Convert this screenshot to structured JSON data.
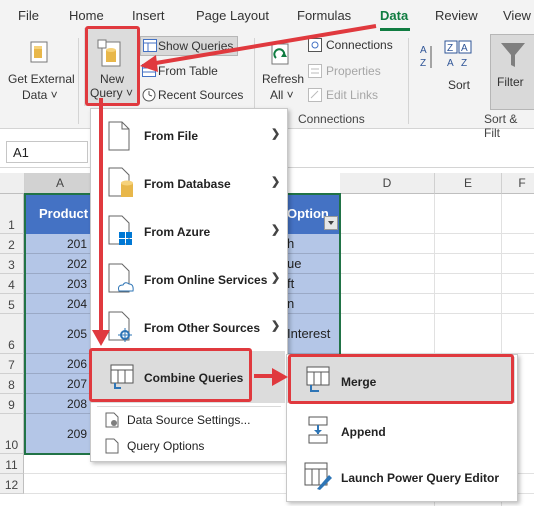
{
  "tabs": [
    "File",
    "Home",
    "Insert",
    "Page Layout",
    "Formulas",
    "Data",
    "Review",
    "View"
  ],
  "ribbon": {
    "get_external_data": [
      "Get External",
      "Data ˅"
    ],
    "new_query": [
      "New",
      "Query ˅"
    ],
    "show_queries": "Show Queries",
    "from_table": "From Table",
    "recent_sources": "Recent Sources",
    "refresh_all": [
      "Refresh",
      "All ˅"
    ],
    "connections": "Connections",
    "properties": "Properties",
    "edit_links": "Edit Links",
    "connections_group": "Connections",
    "sort": "Sort",
    "filter": "Filter",
    "sort_filter_group": "Sort & Filt"
  },
  "name_box": "A1",
  "columns": [
    "A",
    "D",
    "E",
    "F"
  ],
  "rows": [
    "1",
    "2",
    "3",
    "4",
    "5",
    "6",
    "7",
    "8",
    "9",
    "10",
    "11",
    "12"
  ],
  "table": {
    "header_a": "Product",
    "header_c": "Option",
    "col_a": [
      "201",
      "202",
      "203",
      "204",
      "205",
      "206",
      "207",
      "208",
      "209"
    ],
    "col_c": [
      "h",
      "ue",
      "ft",
      "n",
      "Interest",
      "",
      "",
      "",
      ""
    ]
  },
  "new_query_menu": {
    "from_file": "From File",
    "from_database": "From Database",
    "from_azure": "From Azure",
    "from_online": "From Online Services",
    "from_other": "From Other Sources",
    "combine": "Combine Queries",
    "data_source_settings": "Data Source Settings...",
    "query_options": "Query Options"
  },
  "combine_menu": {
    "merge": "Merge",
    "append": "Append",
    "launch_editor": "Launch Power Query Editor"
  },
  "colors": {
    "accent": "#107c41",
    "highlight": "#e0393e",
    "table_fill": "#b4c6e7",
    "table_header": "#4472c4"
  }
}
